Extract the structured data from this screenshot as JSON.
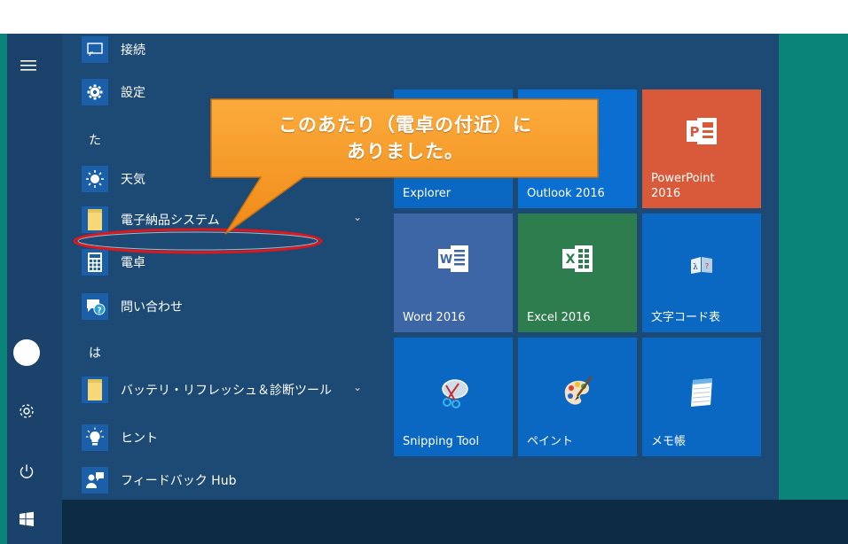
{
  "app_list": {
    "items_top": [
      {
        "label": "接続",
        "icon": "connect-icon"
      },
      {
        "label": "設定",
        "icon": "gear-icon"
      }
    ],
    "section_ta": "た",
    "items_ta": [
      {
        "label": "天気",
        "icon": "weather-sun-icon"
      },
      {
        "label": "電子納品システム",
        "icon": "folder-icon"
      },
      {
        "label": "電卓",
        "icon": "calculator-icon"
      },
      {
        "label": "問い合わせ",
        "icon": "contact-support-icon"
      }
    ],
    "section_ha": "は",
    "items_ha": [
      {
        "label": "バッテリ・リフレッシュ＆診断ツール",
        "icon": "folder-icon"
      },
      {
        "label": "ヒント",
        "icon": "lightbulb-icon"
      },
      {
        "label": "フィードバック Hub",
        "icon": "feedback-icon"
      }
    ]
  },
  "tiles": {
    "explorer": "Explorer",
    "outlook": "Outlook 2016",
    "powerpoint": "PowerPoint\n2016",
    "word": "Word 2016",
    "excel": "Excel 2016",
    "charmap": "文字コード表",
    "snipping": "Snipping Tool",
    "paint": "ペイント",
    "notepad": "メモ帳"
  },
  "callout": {
    "line1": "このあたり（電卓の付近）に",
    "line2": "ありました。"
  },
  "colors": {
    "start_bg": "#1d4a74",
    "tile_blue": "#0a67c2",
    "word": "#2b579a",
    "excel": "#217346",
    "powerpoint": "#d24726",
    "callout": "#f7921e",
    "highlight": "#e0161b"
  }
}
